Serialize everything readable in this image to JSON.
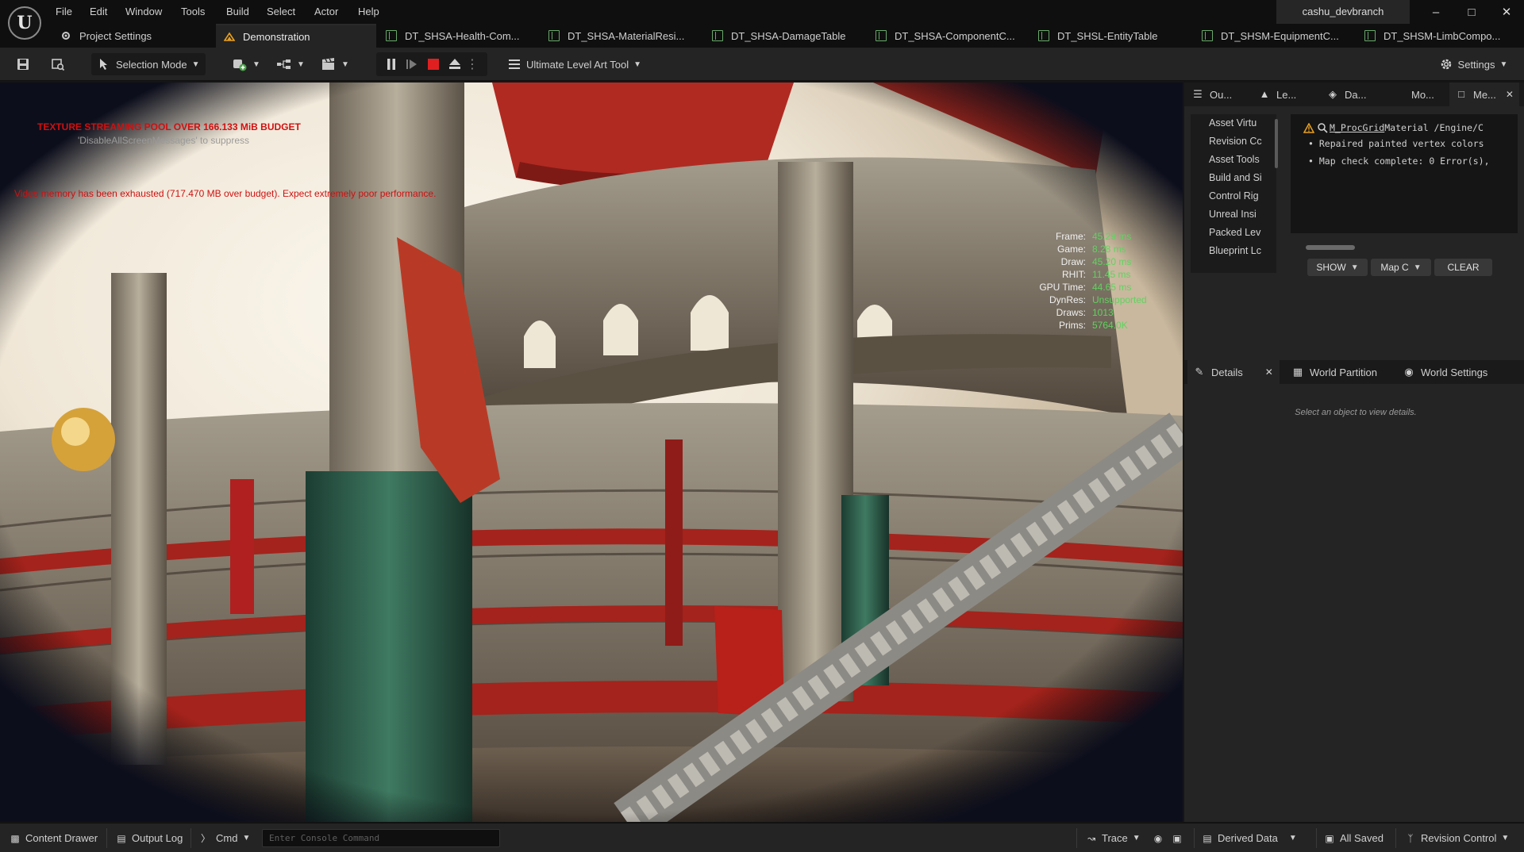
{
  "menu": [
    "File",
    "Edit",
    "Window",
    "Tools",
    "Build",
    "Select",
    "Actor",
    "Help"
  ],
  "branch": "cashu_devbranch",
  "tabs": [
    {
      "label": "Project Settings",
      "icon": "gear-icon"
    },
    {
      "label": "Demonstration",
      "icon": "level-icon",
      "active": true
    },
    {
      "label": "DT_SHSA-Health-Com...",
      "icon": "datatable-icon"
    },
    {
      "label": "DT_SHSA-MaterialResi...",
      "icon": "datatable-icon"
    },
    {
      "label": "DT_SHSA-DamageTable",
      "icon": "datatable-icon"
    },
    {
      "label": "DT_SHSA-ComponentC...",
      "icon": "datatable-icon"
    },
    {
      "label": "DT_SHSL-EntityTable",
      "icon": "datatable-icon"
    },
    {
      "label": "DT_SHSM-EquipmentC...",
      "icon": "datatable-icon"
    },
    {
      "label": "DT_SHSM-LimbCompo...",
      "icon": "datatable-icon"
    }
  ],
  "toolbar": {
    "selection_mode": "Selection Mode",
    "level_art_tool": "Ultimate Level Art Tool",
    "settings": "Settings"
  },
  "viewport": {
    "warning1": "TEXTURE STREAMING POOL OVER 166.133 MiB BUDGET",
    "warning1_sub": "'DisableAllScreenMessages' to suppress",
    "warning2": "Video memory has been exhausted (717.470 MB over budget). Expect extremely poor performance.",
    "stats": [
      {
        "k": "Frame:",
        "v": "45.29 ms"
      },
      {
        "k": "Game:",
        "v": "8.28 ms"
      },
      {
        "k": "Draw:",
        "v": "45.20 ms"
      },
      {
        "k": "RHIT:",
        "v": "11.45 ms"
      },
      {
        "k": "GPU Time:",
        "v": "44.65 ms"
      },
      {
        "k": "DynRes:",
        "v": "Unsupported"
      },
      {
        "k": "Draws:",
        "v": "1013"
      },
      {
        "k": "Prims:",
        "v": "5764.0K"
      }
    ]
  },
  "right_tabs_top": [
    {
      "label": "Ou...",
      "icon": "outliner-icon"
    },
    {
      "label": "Le...",
      "icon": "levels-icon"
    },
    {
      "label": "Da...",
      "icon": "layers-icon"
    },
    {
      "label": "Mo...",
      "icon": ""
    },
    {
      "label": "Me...",
      "icon": "message-log-icon",
      "active": true
    }
  ],
  "message_categories": [
    "Asset Virtu",
    "Revision Cc",
    "Asset Tools",
    "Build and Si",
    "Control Rig",
    "Unreal Insi",
    "Packed Lev",
    "Blueprint Lc"
  ],
  "messages": {
    "head_link": "M_ProcGrid",
    "head_rest": " Material /Engine/C",
    "lines": [
      "Repaired painted vertex colors",
      "Map check complete: 0 Error(s),"
    ],
    "show_btn": "SHOW",
    "map_btn": "Map C",
    "clear_btn": "CLEAR"
  },
  "right_tabs_bottom": [
    {
      "label": "Details",
      "icon": "pencil-icon",
      "active": true
    },
    {
      "label": "World Partition",
      "icon": "grid-icon"
    },
    {
      "label": "World Settings",
      "icon": "globe-icon"
    }
  ],
  "details_hint": "Select an object to view details.",
  "statusbar": {
    "content_drawer": "Content Drawer",
    "output_log": "Output Log",
    "cmd": "Cmd",
    "console_placeholder": "Enter Console Command",
    "trace": "Trace",
    "derived_data": "Derived Data",
    "all_saved": "All Saved",
    "revision_control": "Revision Control"
  },
  "colors": {
    "accent_warning": "#e8a020",
    "stat_green": "#5fd35f",
    "warning_red": "#d01010",
    "record_red": "#e02020"
  }
}
